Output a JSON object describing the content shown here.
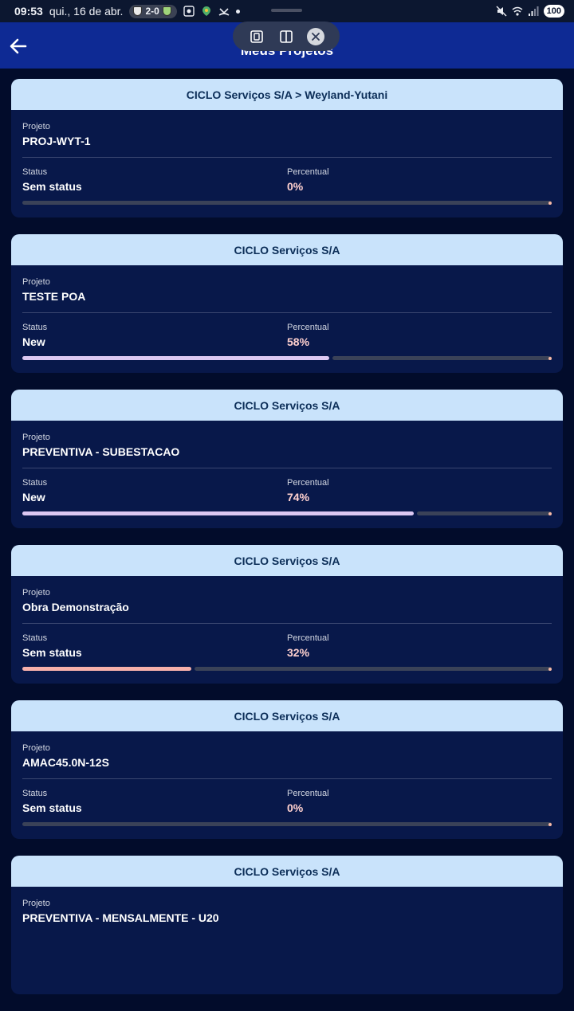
{
  "status_bar": {
    "time": "09:53",
    "date": "qui., 16 de abr.",
    "score": "2-0",
    "battery": "100"
  },
  "app_bar": {
    "title": "Meus Projetos"
  },
  "labels": {
    "project": "Projeto",
    "status": "Status",
    "percent": "Percentual"
  },
  "projects": [
    {
      "client": "CICLO Serviços S/A > Weyland-Yutani",
      "name": "PROJ-WYT-1",
      "status": "Sem status",
      "percent_label": "0%",
      "progress": 0
    },
    {
      "client": "CICLO Serviços S/A",
      "name": "TESTE POA",
      "status": "New",
      "percent_label": "58%",
      "progress": 0.58
    },
    {
      "client": "CICLO Serviços S/A",
      "name": "PREVENTIVA - SUBESTACAO",
      "status": "New",
      "percent_label": "74%",
      "progress": 0.74
    },
    {
      "client": "CICLO Serviços S/A",
      "name": "Obra Demonstração",
      "status": "Sem status",
      "percent_label": "32%",
      "progress": 0.32
    },
    {
      "client": "CICLO Serviços S/A",
      "name": "AMAC45.0N-12S",
      "status": "Sem status",
      "percent_label": "0%",
      "progress": 0
    },
    {
      "client": "CICLO Serviços S/A",
      "name": "PREVENTIVA - MENSALMENTE - U20"
    }
  ],
  "colors": {
    "app_bar": "#0e2a94",
    "card_header": "#c9e3fb",
    "card_body": "#08184a",
    "progress_fill": "#dcc8f2",
    "progress_low": "#f6b0ab"
  }
}
